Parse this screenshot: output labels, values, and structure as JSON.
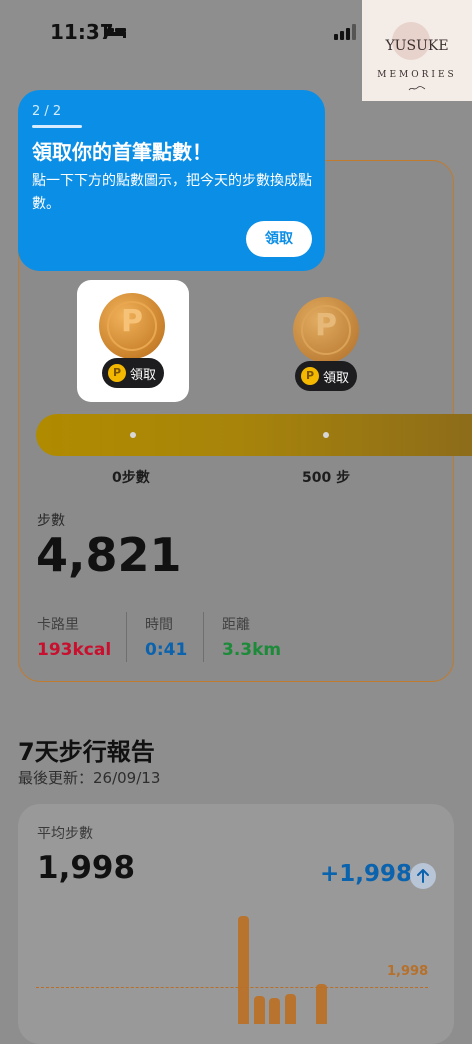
{
  "status_bar": {
    "time": "11:37",
    "icons": [
      "bed-icon",
      "signal-icon"
    ]
  },
  "watermark": {
    "title": "YUSUKE",
    "subtitle": "MEMORIES",
    "signature": "signature-mark"
  },
  "tooltip": {
    "step": "2 / 2",
    "title": "領取你的首筆點數！",
    "body": "點一下下方的點數圖示，把今天的步數換成點數。",
    "button": "領取"
  },
  "milestones": [
    {
      "label": "0步數",
      "claim_label": "領取",
      "coin_letter": "P"
    },
    {
      "label": "500 步",
      "claim_label": "領取",
      "coin_letter": "P"
    }
  ],
  "steps": {
    "label": "步數",
    "value": "4,821"
  },
  "stats": [
    {
      "label": "卡路里",
      "value": "193kcal",
      "color": "#c8102e"
    },
    {
      "label": "時間",
      "value": "0:41",
      "color": "#0b62ad"
    },
    {
      "label": "距離",
      "value": "3.3km",
      "color": "#1d8a3a"
    }
  ],
  "report": {
    "title": "7天步行報告",
    "updated": "最後更新：26/09/13",
    "avg_label": "平均步數",
    "avg_value": "1,998",
    "delta": "+1,998",
    "avg_line_label": "1,998"
  },
  "colors": {
    "accent": "#0b8ee6",
    "card_border": "#c07b2e",
    "bar": "#b8732e"
  }
}
